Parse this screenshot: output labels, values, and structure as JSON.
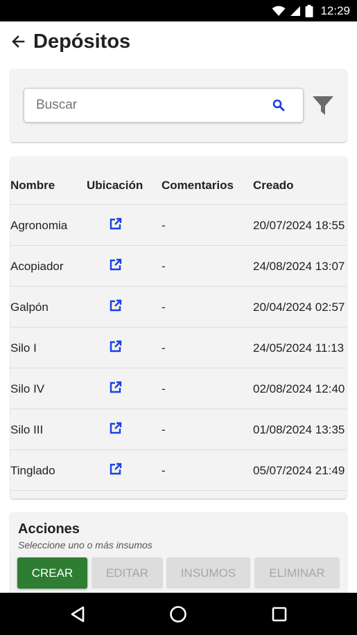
{
  "status_bar": {
    "time": "12:29",
    "icons": [
      "wifi-icon",
      "signal-icon",
      "battery-icon"
    ]
  },
  "header": {
    "title": "Depósitos",
    "back_icon": "arrow-back-icon"
  },
  "search": {
    "placeholder": "Buscar",
    "value": "",
    "icon": "search-icon",
    "filter_icon": "filter-icon"
  },
  "table": {
    "columns": [
      "Nombre",
      "Ubicación",
      "Comentarios",
      "Creado"
    ],
    "rows": [
      {
        "nombre": "Agronomia",
        "comentarios": "-",
        "creado": "20/07/2024 18:55"
      },
      {
        "nombre": "Acopiador",
        "comentarios": "-",
        "creado": "24/08/2024 13:07"
      },
      {
        "nombre": "Galpón",
        "comentarios": "-",
        "creado": "20/04/2024 02:57"
      },
      {
        "nombre": "Silo I",
        "comentarios": "-",
        "creado": "24/05/2024 11:13"
      },
      {
        "nombre": "Silo IV",
        "comentarios": "-",
        "creado": "02/08/2024 12:40"
      },
      {
        "nombre": "Silo III",
        "comentarios": "-",
        "creado": "01/08/2024 13:35"
      },
      {
        "nombre": "Tinglado",
        "comentarios": "-",
        "creado": "05/07/2024 21:49"
      }
    ]
  },
  "actions": {
    "title": "Acciones",
    "subtitle": "Seleccione uno o más insumos",
    "buttons": {
      "create": "CREAR",
      "edit": "EDITAR",
      "supplies": "INSUMOS",
      "delete": "ELIMINAR"
    }
  },
  "colors": {
    "primary_green": "#2e7d32",
    "link_blue": "#1a3ee6",
    "card_bg": "#f3f3f3"
  }
}
